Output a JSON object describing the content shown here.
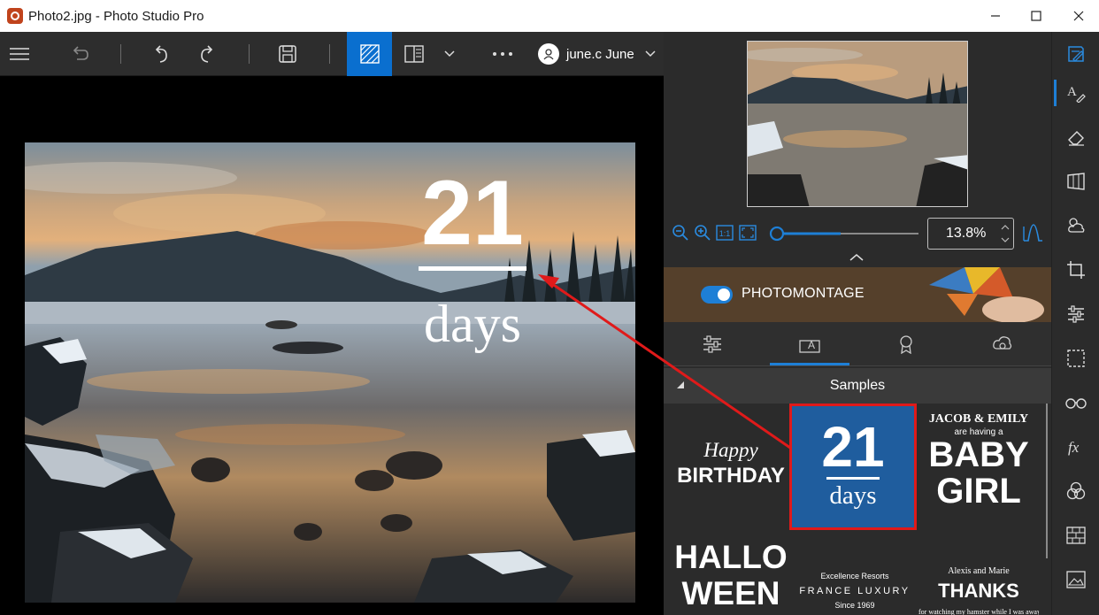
{
  "window": {
    "title": "Photo2.jpg - Photo Studio Pro"
  },
  "toolbar": {
    "user_name": "june.c June"
  },
  "photo_overlay": {
    "number": "21",
    "word": "days"
  },
  "navigator": {
    "zoom_value": "13.8%"
  },
  "montage": {
    "label": "PHOTOMONTAGE"
  },
  "samples": {
    "header": "Samples",
    "happy_line1": "Happy",
    "happy_line2": "BIRTHDAY",
    "days_number": "21",
    "days_word": "days",
    "baby_line1": "JACOB & EMILY",
    "baby_line2": "are having a",
    "baby_line3": "BABY",
    "baby_line4": "GIRL",
    "hallo_line1": "HALLO",
    "hallo_line2": "WEEN",
    "france_line1": "Excellence Resorts",
    "france_line2": "FRANCE LUXURY",
    "france_line3": "Since 1969",
    "thanks_line1": "Alexis and Marie",
    "thanks_line2": "THANKS",
    "thanks_line3": "for watching my hamster while I was away"
  },
  "colors": {
    "accent": "#1e7fd6",
    "highlight": "#e01a1a",
    "sample_blue": "#1f5d9e"
  }
}
